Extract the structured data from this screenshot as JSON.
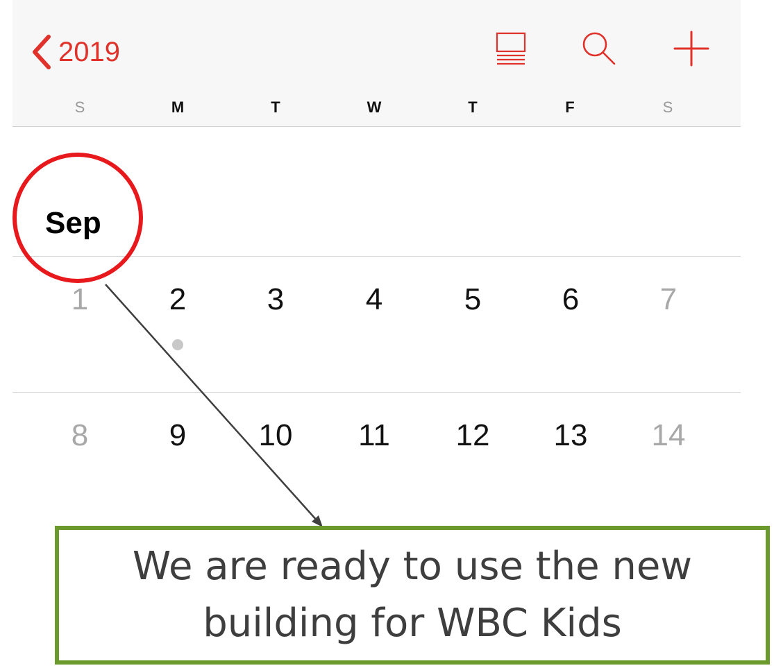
{
  "nav": {
    "back_label": "2019",
    "icons": [
      "list-view-icon",
      "search-icon",
      "plus-icon"
    ],
    "accent_color": "#e0312a"
  },
  "weekdays": [
    "S",
    "M",
    "T",
    "W",
    "T",
    "F",
    "S"
  ],
  "month": {
    "label": "Sep"
  },
  "weeks": [
    {
      "days": [
        "1",
        "2",
        "3",
        "4",
        "5",
        "6",
        "7"
      ]
    },
    {
      "days": [
        "8",
        "9",
        "10",
        "11",
        "12",
        "13",
        "14"
      ]
    }
  ],
  "events": {
    "days_with_event_dot": [
      "2"
    ]
  },
  "annotation": {
    "highlight_color": "#e8191c",
    "callout_border_color": "#6a9a2c",
    "callout_line1": "We are ready to use the new",
    "callout_line2": "building for WBC Kids"
  }
}
